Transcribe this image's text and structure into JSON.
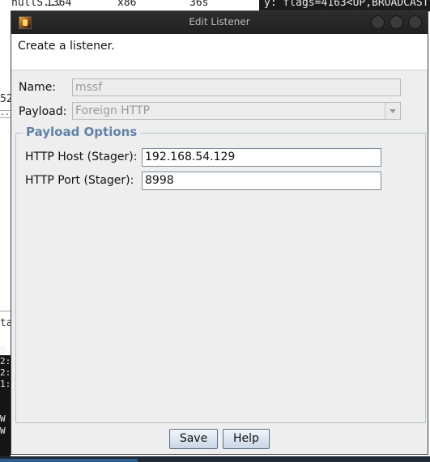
{
  "background": {
    "top_row": {
      "col1": "hullS...",
      "col2": "1364",
      "col3": "x86",
      "col4": "36s"
    },
    "terminal_top": "y: flags=4163<UP,BROADCAST",
    "left_fragments": [
      "52",
      "...",
      "ta",
      "0:",
      "2:",
      "2:",
      "1:",
      "W",
      "W"
    ]
  },
  "dialog": {
    "title": "Edit Listener",
    "description": "Create a listener.",
    "name": {
      "label": "Name:",
      "value": "mssf"
    },
    "payload": {
      "label": "Payload:",
      "value": "Foreign HTTP"
    },
    "payload_options": {
      "title": "Payload Options",
      "host": {
        "label": "HTTP Host (Stager):",
        "value": "192.168.54.129"
      },
      "port": {
        "label": "HTTP Port (Stager):",
        "value": "8998"
      }
    },
    "buttons": {
      "save": "Save",
      "help": "Help"
    }
  }
}
